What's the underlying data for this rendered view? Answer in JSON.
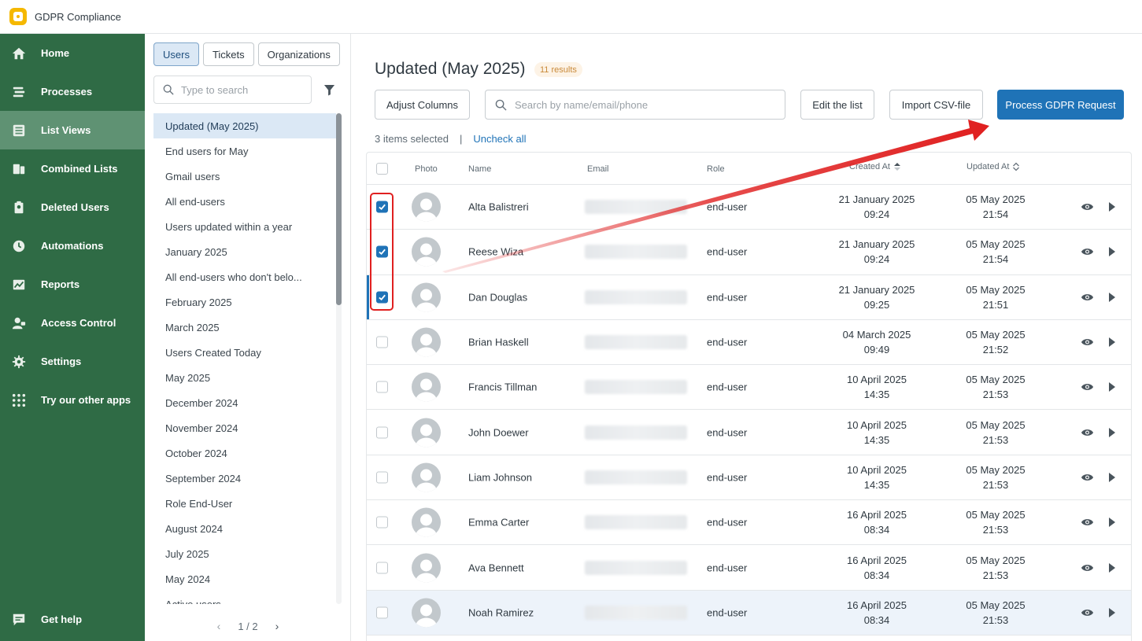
{
  "app": {
    "title": "GDPR Compliance"
  },
  "sidebar": {
    "items": [
      {
        "label": "Home",
        "icon": "home-icon"
      },
      {
        "label": "Processes",
        "icon": "processes-icon"
      },
      {
        "label": "List Views",
        "icon": "list-views-icon",
        "active": true
      },
      {
        "label": "Combined Lists",
        "icon": "combined-lists-icon"
      },
      {
        "label": "Deleted Users",
        "icon": "deleted-users-icon"
      },
      {
        "label": "Automations",
        "icon": "clock-icon"
      },
      {
        "label": "Reports",
        "icon": "reports-icon"
      },
      {
        "label": "Access Control",
        "icon": "access-control-icon"
      },
      {
        "label": "Settings",
        "icon": "gear-icon"
      },
      {
        "label": "Try our other apps",
        "icon": "apps-grid-icon"
      }
    ],
    "help": {
      "label": "Get help",
      "icon": "chat-icon"
    }
  },
  "listviews": {
    "tabs": [
      "Users",
      "Tickets",
      "Organizations"
    ],
    "active_tab": "Users",
    "search_placeholder": "Type to search",
    "items": [
      "Updated (May 2025)",
      "End users for May",
      "Gmail users",
      "All end-users",
      "Users updated within a year",
      "January 2025",
      "All end-users who don't belo...",
      "February 2025",
      "March 2025",
      "Users Created Today",
      "May 2025",
      "December 2024",
      "November 2024",
      "October 2024",
      "September 2024",
      "Role End-User",
      "August 2024",
      "July 2025",
      "May 2024",
      "Active users"
    ],
    "active_item": "Updated (May 2025)",
    "pager": {
      "label": "1 / 2"
    }
  },
  "main": {
    "title": "Updated (May 2025)",
    "results_badge": "11 results",
    "buttons": {
      "adjust_columns": "Adjust Columns",
      "edit_list": "Edit the list",
      "import_csv": "Import CSV-file",
      "process_gdpr": "Process GDPR Request"
    },
    "search_placeholder": "Search by name/email/phone",
    "selection": {
      "count_text": "3 items selected",
      "separator": "|",
      "uncheck_all": "Uncheck all"
    },
    "columns": {
      "photo": "Photo",
      "name": "Name",
      "email": "Email",
      "role": "Role",
      "created_at": "Created At",
      "updated_at": "Updated At"
    },
    "rows": [
      {
        "name": "Alta Balistreri",
        "role": "end-user",
        "created_date": "21 January 2025",
        "created_time": "09:24",
        "updated_date": "05 May 2025",
        "updated_time": "21:54",
        "checked": true
      },
      {
        "name": "Reese Wiza",
        "role": "end-user",
        "created_date": "21 January 2025",
        "created_time": "09:24",
        "updated_date": "05 May 2025",
        "updated_time": "21:54",
        "checked": true
      },
      {
        "name": "Dan Douglas",
        "role": "end-user",
        "created_date": "21 January 2025",
        "created_time": "09:25",
        "updated_date": "05 May 2025",
        "updated_time": "21:51",
        "checked": true
      },
      {
        "name": "Brian Haskell",
        "role": "end-user",
        "created_date": "04 March 2025",
        "created_time": "09:49",
        "updated_date": "05 May 2025",
        "updated_time": "21:52",
        "checked": false
      },
      {
        "name": "Francis Tillman",
        "role": "end-user",
        "created_date": "10 April 2025",
        "created_time": "14:35",
        "updated_date": "05 May 2025",
        "updated_time": "21:53",
        "checked": false
      },
      {
        "name": "John Doewer",
        "role": "end-user",
        "created_date": "10 April 2025",
        "created_time": "14:35",
        "updated_date": "05 May 2025",
        "updated_time": "21:53",
        "checked": false
      },
      {
        "name": "Liam Johnson",
        "role": "end-user",
        "created_date": "10 April 2025",
        "created_time": "14:35",
        "updated_date": "05 May 2025",
        "updated_time": "21:53",
        "checked": false
      },
      {
        "name": "Emma Carter",
        "role": "end-user",
        "created_date": "16 April 2025",
        "created_time": "08:34",
        "updated_date": "05 May 2025",
        "updated_time": "21:53",
        "checked": false
      },
      {
        "name": "Ava Bennett",
        "role": "end-user",
        "created_date": "16 April 2025",
        "created_time": "08:34",
        "updated_date": "05 May 2025",
        "updated_time": "21:53",
        "checked": false
      },
      {
        "name": "Noah Ramirez",
        "role": "end-user",
        "created_date": "16 April 2025",
        "created_time": "08:34",
        "updated_date": "05 May 2025",
        "updated_time": "21:53",
        "checked": false
      }
    ]
  },
  "colors": {
    "sidebar_bg": "#2f6b45",
    "sidebar_active": "#5f9273",
    "primary": "#1f73b7",
    "annotation_red": "#e02020"
  }
}
